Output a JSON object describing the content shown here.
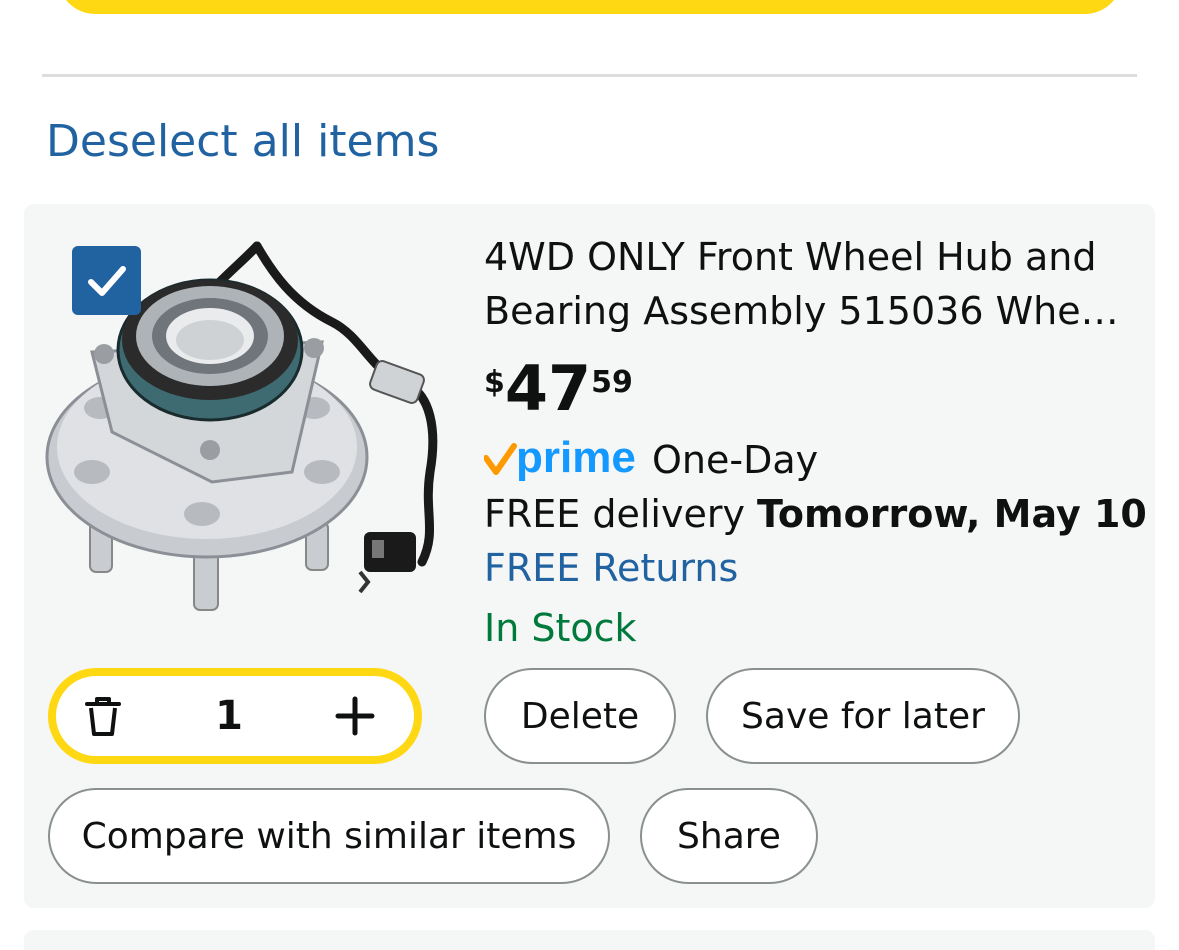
{
  "cart": {
    "deselect_label": "Deselect all items",
    "item": {
      "selected": true,
      "title_line1": "4WD ONLY Front Wheel Hub and",
      "title_line2": "Bearing Assembly 515036 Whe…",
      "price": {
        "symbol": "$",
        "whole": "47",
        "fraction": "59"
      },
      "prime": {
        "logo_text": "prime",
        "label": "One-Day"
      },
      "delivery": {
        "prefix": "FREE delivery",
        "date": "Tomorrow, May 10"
      },
      "returns": "FREE Returns",
      "stock": "In Stock",
      "quantity": "1"
    },
    "buttons": {
      "delete": "Delete",
      "save_for_later": "Save for later",
      "compare": "Compare with similar items",
      "share": "Share"
    }
  },
  "colors": {
    "accent_yellow": "#ffd814",
    "link_blue": "#2162a1",
    "stock_green": "#007a3c",
    "prime_blue": "#1399ff",
    "prime_check": "#ff9900",
    "card_bg": "#f5f6f6"
  },
  "icons": {
    "checkbox": "checkmark-icon",
    "trash": "trash-icon",
    "plus": "plus-icon",
    "prime": "prime-logo-icon"
  }
}
